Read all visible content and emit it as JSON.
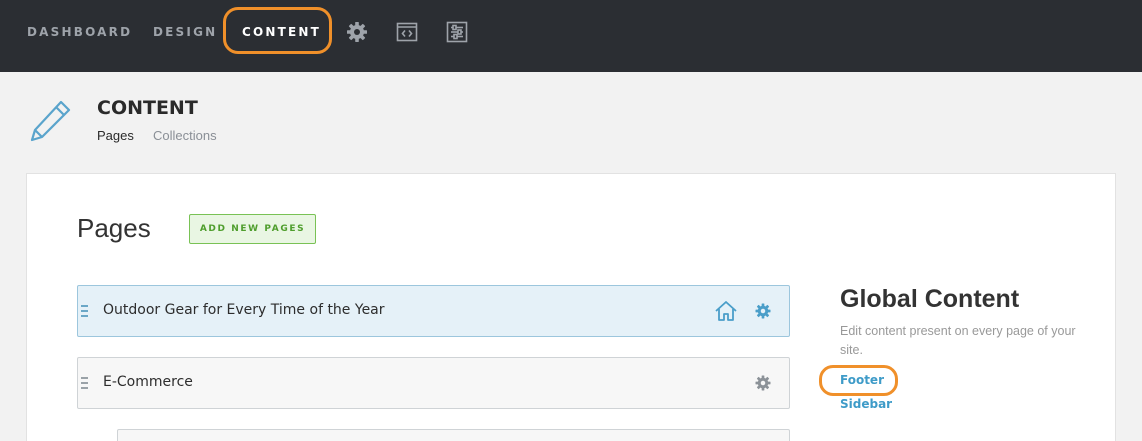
{
  "nav": {
    "items": [
      "DASHBOARD",
      "DESIGN",
      "CONTENT"
    ],
    "icons": [
      "gear-icon",
      "code-window-icon",
      "sliders-panel-icon"
    ]
  },
  "header": {
    "title": "CONTENT",
    "tabs": [
      "Pages",
      "Collections"
    ],
    "icon": "pencil-icon"
  },
  "pages": {
    "heading": "Pages",
    "add_button": "ADD NEW PAGES",
    "rows": [
      {
        "title": "Outdoor Gear for Every Time of the Year",
        "is_home": true
      },
      {
        "title": "E-Commerce",
        "is_home": false
      }
    ]
  },
  "global_content": {
    "title": "Global Content",
    "description": "Edit content present on every page of your site.",
    "links": [
      "Footer",
      "Sidebar"
    ]
  },
  "colors": {
    "topbar": "#2b2e33",
    "highlight": "#f0902a",
    "link": "#3e9bc8",
    "add_button_green": "#4f9e2d",
    "active_row": "#e5f1f8"
  }
}
